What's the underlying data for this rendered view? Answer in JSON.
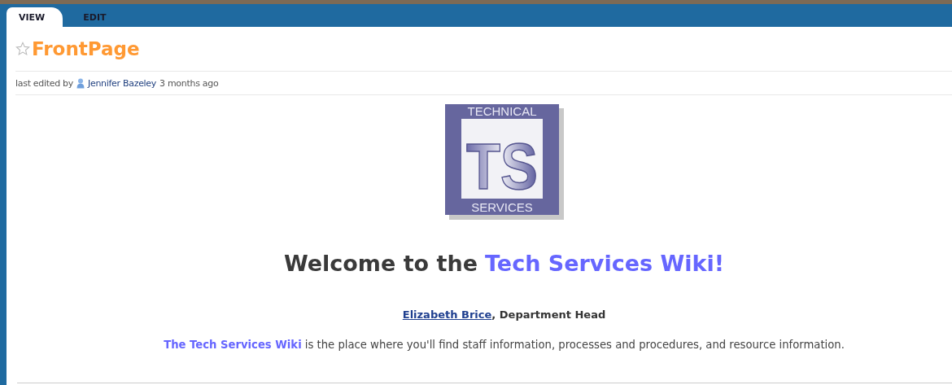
{
  "tabs": [
    {
      "label": "VIEW",
      "selected": true
    },
    {
      "label": "EDIT",
      "selected": false
    }
  ],
  "page": {
    "title": "FrontPage",
    "starred": false,
    "meta": {
      "prefix": "last edited by",
      "author": "Jennifer Bazeley",
      "time": "3 months ago"
    }
  },
  "logo": {
    "top": "TECHNICAL",
    "monogram": "TS",
    "bottom": "SERVICES"
  },
  "heading": {
    "lead": "Welcome to the",
    "highlight": "Tech Services Wiki!"
  },
  "byline": {
    "name": "Elizabeth Brice",
    "role": ", Department Head"
  },
  "intro": {
    "link": "The Tech Services Wiki",
    "text": " is the place where you'll find staff information, processes and procedures, and resource information."
  }
}
